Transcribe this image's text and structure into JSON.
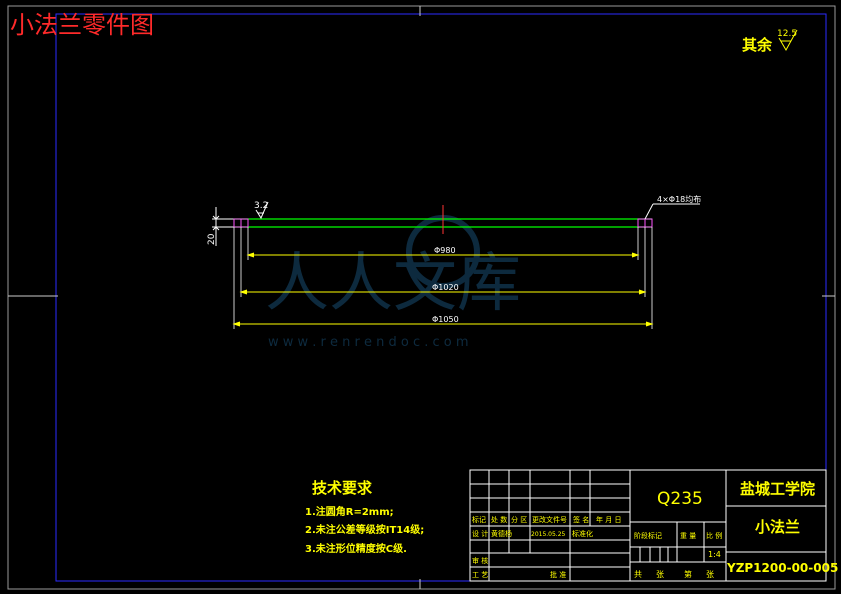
{
  "page_title": "小法兰零件图",
  "roughness_note": {
    "label": "其余",
    "value": "12.5"
  },
  "drawing": {
    "roughness_mark": "3.2",
    "height_dim": "20",
    "hole_note": "4×Φ18均布",
    "dims": {
      "inner": "Φ980",
      "middle": "Φ1020",
      "outer": "Φ1050"
    }
  },
  "watermark": {
    "text": "人人文库",
    "url": "w w w . r e n r e n d o c . c o m"
  },
  "tech_requirements": {
    "title": "技术要求",
    "items": [
      "1.注圆角R=2mm;",
      "2.未注公差等级按IT14级;",
      "3.未注形位精度按C级."
    ]
  },
  "title_block": {
    "material": "Q235",
    "school": "盐城工学院",
    "part_name": "小法兰",
    "drawing_no": "YZP1200-00-005",
    "scale": "1:4",
    "headers": [
      "标记",
      "处 数",
      "分 区",
      "更改文件号",
      "签 名",
      "年 月 日"
    ],
    "design_row": [
      "设 计",
      "黄德杨",
      "2015.05.25",
      "标准化"
    ],
    "stage_label": "阶段标记",
    "weight_label": "重 量",
    "scale_label": "比 例",
    "review_label": "审 核",
    "process_label": "工 艺",
    "approve_label": "批 准",
    "sheets": [
      "共",
      "张",
      "第",
      "张"
    ]
  }
}
